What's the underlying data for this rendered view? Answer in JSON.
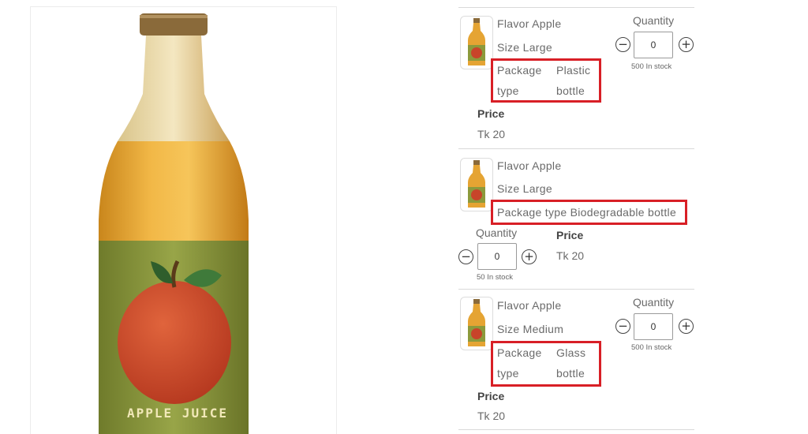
{
  "product_image": {
    "label_text": "APPLE JUICE",
    "icon": "apple-juice-bottle-image"
  },
  "variants": [
    {
      "flavor": "Flavor Apple",
      "size": "Size Large",
      "package_key": "Package",
      "package_key_2": "type",
      "package_val": "Plastic",
      "package_val_2": "bottle",
      "price_label": "Price",
      "price_value": "Tk 20",
      "quantity_label": "Quantity",
      "quantity_value": "0",
      "stock": "500 In stock"
    },
    {
      "flavor": "Flavor Apple",
      "size": "Size Large",
      "package_full": "Package type Biodegradable bottle",
      "price_label": "Price",
      "price_value": "Tk 20",
      "quantity_label": "Quantity",
      "quantity_value": "0",
      "stock": "50 In stock"
    },
    {
      "flavor": "Flavor Apple",
      "size": "Size Medium",
      "package_key": "Package",
      "package_key_2": "type",
      "package_val": "Glass",
      "package_val_2": "bottle",
      "price_label": "Price",
      "price_value": "Tk 20",
      "quantity_label": "Quantity",
      "quantity_value": "0",
      "stock": "500 In stock"
    }
  ],
  "controls": {
    "minus_glyph": "−",
    "plus_glyph": "+"
  },
  "colors": {
    "highlight": "#d81f26",
    "juice": "#e9a735",
    "label_green": "#8c9a3c",
    "apple_red": "#c8442a"
  }
}
